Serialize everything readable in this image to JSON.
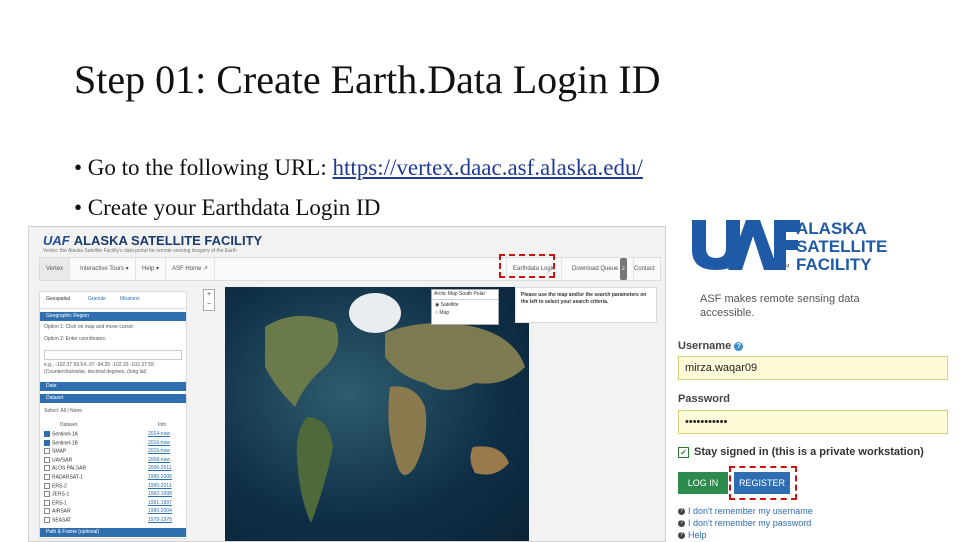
{
  "slide": {
    "title": "Step 01: Create Earth.Data Login ID",
    "bullet1_prefix": "• Go to the following URL: ",
    "bullet1_link": "https://vertex.daac.asf.alaska.edu/",
    "bullet2": "• Create your Earthdata Login ID"
  },
  "vertex": {
    "brand_uaf": "UAF",
    "brand_name": "ALASKA SATELLITE FACILITY",
    "tagline": "Vertex: the Alaska Satellite Facility's data portal for remote sensing imagery of the Earth",
    "nav": [
      "Vertex",
      "Interactive Tours ▾",
      "Help ▾",
      "ASF Home ↗",
      "Earthdata Login",
      "Download Queue",
      "Contact"
    ],
    "queue_count": "2",
    "side_tabs": [
      "Geospatial",
      "Granule",
      "Missions"
    ],
    "section_geo": "Geographic Region",
    "opt1": "Option 1: Click on map and move cursor",
    "opt2": "Option 2: Enter coordinates:",
    "coord_example": "e.g., -102.37 59.54,-37 -94.35 -102.33 -102.37 59",
    "coord_hint": "(Counterclockwise, decimal degrees, (long lat)",
    "section_date": "Date",
    "section_dataset": "Dataset",
    "select_all": "Select: All | None",
    "col_dataset": "Dataset",
    "col_info": "Info",
    "section_path": "Path & Frame (optional)",
    "datasets": [
      {
        "name": "Sentinel-1A",
        "dates": "2014-now",
        "checked": true
      },
      {
        "name": "Sentinel-1B",
        "dates": "2016-now",
        "checked": true
      },
      {
        "name": "SMAP",
        "dates": "2015-now",
        "checked": false
      },
      {
        "name": "UAVSAR",
        "dates": "2008-now",
        "checked": false
      },
      {
        "name": "ALOS PALSAR",
        "dates": "2006-2011",
        "checked": false
      },
      {
        "name": "RADARSAT-1",
        "dates": "1995-2008",
        "checked": false
      },
      {
        "name": "ERS-2",
        "dates": "1995-2011",
        "checked": false
      },
      {
        "name": "JERS-1",
        "dates": "1992-1998",
        "checked": false
      },
      {
        "name": "ERS-1",
        "dates": "1991-1997",
        "checked": false
      },
      {
        "name": "AIRSAR",
        "dates": "1990-2004",
        "checked": false
      },
      {
        "name": "SEASAT",
        "dates": "1978-1978",
        "checked": false
      }
    ],
    "map_tabs": "Arctic Map  South Polar",
    "layer_satellite": "Satellite",
    "layer_map": "Map",
    "info_text": "Please use the map and/or the search parameters on the left to select your search criteria.",
    "zoom_in": "+",
    "zoom_out": "−"
  },
  "login": {
    "logo_uaf": "UAF",
    "logo_line1": "ALASKA",
    "logo_line2": "SATELLITE",
    "logo_line3": "FACILITY",
    "trademark": "TM",
    "description_line1": "ASF makes remote sensing data",
    "description_line2": "accessible.",
    "username_label": "Username",
    "username_value": "mirza.waqar09",
    "password_label": "Password",
    "password_value": "•••••••••••",
    "stay_signed_in": "Stay signed in (this is a private workstation)",
    "login_button": "LOG IN",
    "register_button": "REGISTER",
    "help_links": [
      "I don't remember my username",
      "I don't remember my password",
      "Help"
    ]
  },
  "colors": {
    "highlight": "#cc1111",
    "asf_blue": "#1f5aa6",
    "login_green": "#2e8b4e",
    "register_blue": "#2f6db3"
  }
}
